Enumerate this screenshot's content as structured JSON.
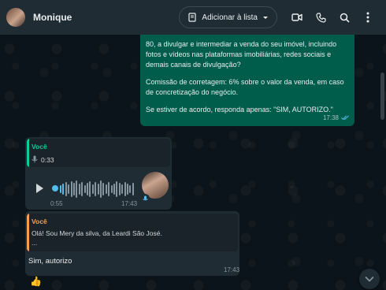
{
  "header": {
    "contact_name": "Monique",
    "add_list_label": "Adicionar à lista"
  },
  "messages": {
    "outgoing": {
      "paragraphs": [
        "80, a divulgar e intermediar a venda do seu imóvel, incluindo fotos e vídeos nas plataformas imobiliárias, redes sociais e demais canais de divulgação?",
        "Comissão de corretagem: 6% sobre o valor da venda, em caso de concretização do negócio.",
        "Se estiver de acordo, responda apenas: \"SIM, AUTORIZO.\""
      ],
      "time": "17:38",
      "status": "read"
    },
    "voice": {
      "quote_author": "Você",
      "quote_duration": "0:33",
      "duration": "0:55",
      "time": "17:43"
    },
    "reply": {
      "quote_author": "Você",
      "quote_text": "Olá! Sou Mery da silva, da Leardi São José.",
      "quote_more": "...",
      "text": "Sim, autorizo",
      "time": "17:43"
    },
    "emoji": "👍"
  },
  "colors": {
    "header_bg": "#202c33",
    "outgoing_bg": "#005c4b",
    "incoming_bg": "#202c33",
    "quote_green": "#06cf9c",
    "quote_orange": "#f99f4f",
    "accent_blue": "#53bdeb"
  },
  "icons": [
    "list-add-icon",
    "caret-down-icon",
    "video-call-icon",
    "phone-icon",
    "search-icon",
    "menu-dots-icon",
    "mic-icon",
    "play-icon",
    "double-check-icon",
    "chevron-down-icon"
  ]
}
